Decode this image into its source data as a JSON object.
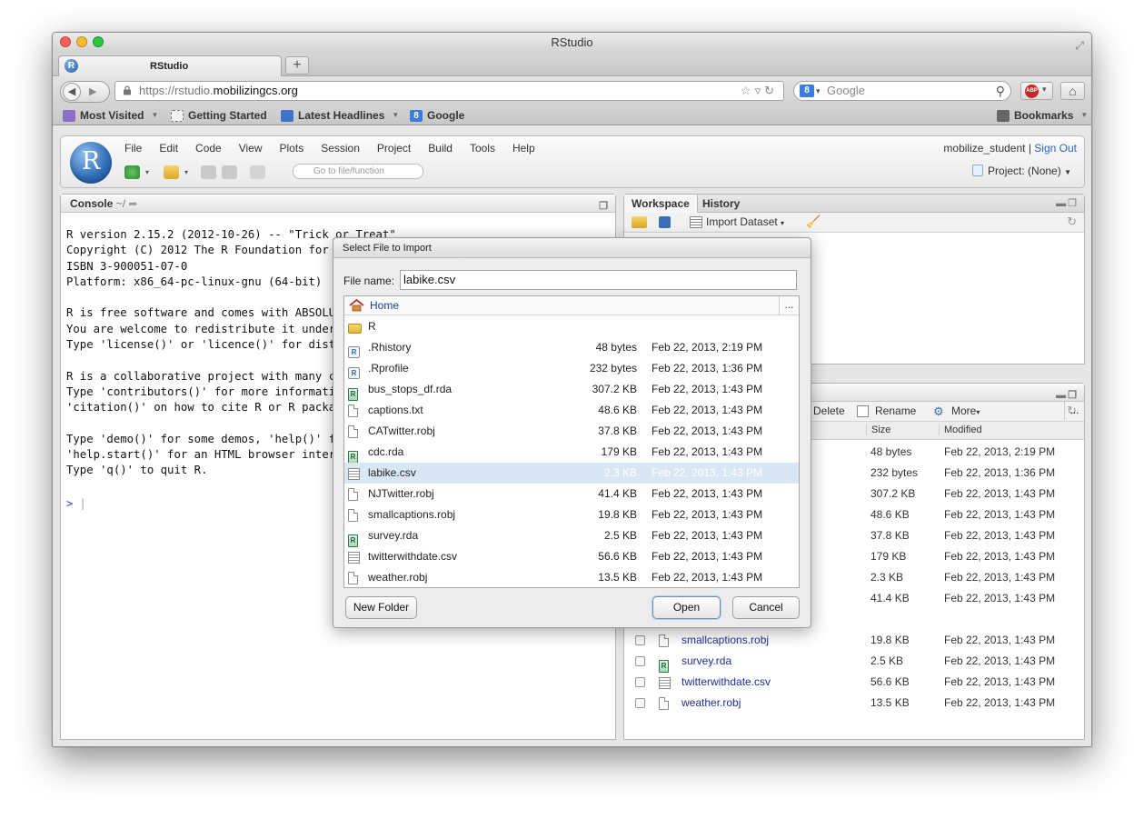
{
  "window": {
    "title": "RStudio"
  },
  "browser": {
    "tab_title": "RStudio",
    "url_prefix": "https://rstudio.",
    "url_domain": "mobilizingcs.org",
    "search_placeholder": "Google",
    "bookmarks": [
      {
        "label": "Most Visited"
      },
      {
        "label": "Getting Started"
      },
      {
        "label": "Latest Headlines"
      },
      {
        "label": "Google"
      }
    ],
    "bookmarks_menu": "Bookmarks"
  },
  "rstudio": {
    "logo_letter": "R",
    "menu": [
      "File",
      "Edit",
      "Code",
      "View",
      "Plots",
      "Session",
      "Project",
      "Build",
      "Tools",
      "Help"
    ],
    "goto_placeholder": "Go to file/function",
    "user": "mobilize_student",
    "separator": "|",
    "sign_out": "Sign Out",
    "project": "Project: (None)"
  },
  "console": {
    "title": "Console",
    "path": "~/",
    "text": "R version 2.15.2 (2012-10-26) -- \"Trick or Treat\"\nCopyright (C) 2012 The R Foundation for S\nISBN 3-900051-07-0\nPlatform: x86_64-pc-linux-gnu (64-bit)\n\nR is free software and comes with ABSOLUT\nYou are welcome to redistribute it under\nType 'license()' or 'licence()' for distr\n\nR is a collaborative project with many co\nType 'contributors()' for more informatio\n'citation()' on how to cite R or R packag\n\nType 'demo()' for some demos, 'help()' fo\n'help.start()' for an HTML browser interf\nType 'q()' to quit R.",
    "prompt": ">"
  },
  "workspace": {
    "tabs": [
      "Workspace",
      "History"
    ],
    "import_label": "Import Dataset"
  },
  "files_panel": {
    "delete_label": "Delete",
    "rename_label": "Rename",
    "more_label": "More",
    "col_size": "Size",
    "col_modified": "Modified",
    "rows": [
      {
        "name": "",
        "size": "48 bytes",
        "modified": "Feb 22, 2013, 2:19 PM",
        "type": "none"
      },
      {
        "name": "",
        "size": "232 bytes",
        "modified": "Feb 22, 2013, 1:36 PM",
        "type": "none"
      },
      {
        "name": "",
        "size": "307.2 KB",
        "modified": "Feb 22, 2013, 1:43 PM",
        "type": "none"
      },
      {
        "name": "",
        "size": "48.6 KB",
        "modified": "Feb 22, 2013, 1:43 PM",
        "type": "none"
      },
      {
        "name": "",
        "size": "37.8 KB",
        "modified": "Feb 22, 2013, 1:43 PM",
        "type": "none"
      },
      {
        "name": "",
        "size": "179 KB",
        "modified": "Feb 22, 2013, 1:43 PM",
        "type": "none"
      },
      {
        "name": "",
        "size": "2.3 KB",
        "modified": "Feb 22, 2013, 1:43 PM",
        "type": "none"
      },
      {
        "name": "",
        "size": "41.4 KB",
        "modified": "Feb 22, 2013, 1:43 PM",
        "type": "none"
      },
      {
        "name": "R",
        "size": "",
        "modified": "",
        "type": "folder"
      },
      {
        "name": "smallcaptions.robj",
        "size": "19.8 KB",
        "modified": "Feb 22, 2013, 1:43 PM",
        "type": "file"
      },
      {
        "name": "survey.rda",
        "size": "2.5 KB",
        "modified": "Feb 22, 2013, 1:43 PM",
        "type": "rda"
      },
      {
        "name": "twitterwithdate.csv",
        "size": "56.6 KB",
        "modified": "Feb 22, 2013, 1:43 PM",
        "type": "csv"
      },
      {
        "name": "weather.robj",
        "size": "13.5 KB",
        "modified": "Feb 22, 2013, 1:43 PM",
        "type": "file"
      }
    ]
  },
  "dialog": {
    "title": "Select File to Import",
    "file_name_label": "File name:",
    "file_name_value": "labike.csv",
    "home_label": "Home",
    "more_label": "...",
    "files": [
      {
        "name": "R",
        "size": "",
        "modified": "",
        "type": "folder"
      },
      {
        "name": ".Rhistory",
        "size": "48 bytes",
        "modified": "Feb 22, 2013, 2:19 PM",
        "type": "r"
      },
      {
        "name": ".Rprofile",
        "size": "232 bytes",
        "modified": "Feb 22, 2013, 1:36 PM",
        "type": "r"
      },
      {
        "name": "bus_stops_df.rda",
        "size": "307.2 KB",
        "modified": "Feb 22, 2013, 1:43 PM",
        "type": "rda"
      },
      {
        "name": "captions.txt",
        "size": "48.6 KB",
        "modified": "Feb 22, 2013, 1:43 PM",
        "type": "file"
      },
      {
        "name": "CATwitter.robj",
        "size": "37.8 KB",
        "modified": "Feb 22, 2013, 1:43 PM",
        "type": "file"
      },
      {
        "name": "cdc.rda",
        "size": "179 KB",
        "modified": "Feb 22, 2013, 1:43 PM",
        "type": "rda"
      },
      {
        "name": "labike.csv",
        "size": "2.3 KB",
        "modified": "Feb 22, 2013, 1:43 PM",
        "type": "csv",
        "selected": true
      },
      {
        "name": "NJTwitter.robj",
        "size": "41.4 KB",
        "modified": "Feb 22, 2013, 1:43 PM",
        "type": "file"
      },
      {
        "name": "smallcaptions.robj",
        "size": "19.8 KB",
        "modified": "Feb 22, 2013, 1:43 PM",
        "type": "file"
      },
      {
        "name": "survey.rda",
        "size": "2.5 KB",
        "modified": "Feb 22, 2013, 1:43 PM",
        "type": "rda"
      },
      {
        "name": "twitterwithdate.csv",
        "size": "56.6 KB",
        "modified": "Feb 22, 2013, 1:43 PM",
        "type": "csv"
      },
      {
        "name": "weather.robj",
        "size": "13.5 KB",
        "modified": "Feb 22, 2013, 1:43 PM",
        "type": "file"
      }
    ],
    "new_folder_label": "New Folder",
    "open_label": "Open",
    "cancel_label": "Cancel"
  },
  "colors": {
    "accent": "#2a63b8",
    "selection": "#d9e7f5",
    "link": "#1c2f9c"
  }
}
